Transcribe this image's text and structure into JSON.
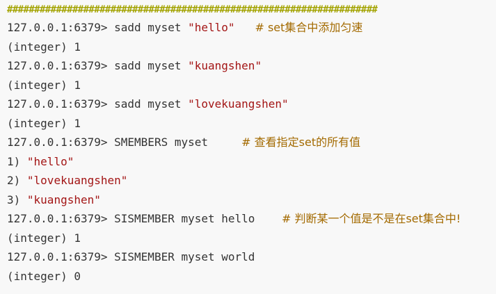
{
  "divider": "####################################################################",
  "lines": [
    {
      "type": "cmd",
      "prompt": "127.0.0.1:6379>",
      "command": "sadd myset ",
      "arg": "\"hello\"",
      "comment": "# set集合中添加匀速"
    },
    {
      "type": "out",
      "text": "(integer) 1"
    },
    {
      "type": "cmd",
      "prompt": "127.0.0.1:6379>",
      "command": "sadd myset ",
      "arg": "\"kuangshen\"",
      "comment": ""
    },
    {
      "type": "out",
      "text": "(integer) 1"
    },
    {
      "type": "cmd",
      "prompt": "127.0.0.1:6379>",
      "command": "sadd myset ",
      "arg": "\"lovekuangshen\"",
      "comment": ""
    },
    {
      "type": "out",
      "text": "(integer) 1"
    },
    {
      "type": "cmd",
      "prompt": "127.0.0.1:6379>",
      "command": "SMEMBERS myset",
      "arg": "",
      "comment": "# 查看指定set的所有值"
    },
    {
      "type": "list",
      "index": "1)",
      "value": "\"hello\""
    },
    {
      "type": "list",
      "index": "2)",
      "value": "\"lovekuangshen\""
    },
    {
      "type": "list",
      "index": "3)",
      "value": "\"kuangshen\""
    },
    {
      "type": "cmd",
      "prompt": "127.0.0.1:6379>",
      "command": "SISMEMBER myset hello",
      "arg": "",
      "comment": "# 判断某一个值是不是在set集合中!"
    },
    {
      "type": "out",
      "text": "(integer) 1"
    },
    {
      "type": "cmd",
      "prompt": "127.0.0.1:6379>",
      "command": "SISMEMBER myset world",
      "arg": "",
      "comment": ""
    },
    {
      "type": "out",
      "text": "(integer) 0"
    }
  ]
}
